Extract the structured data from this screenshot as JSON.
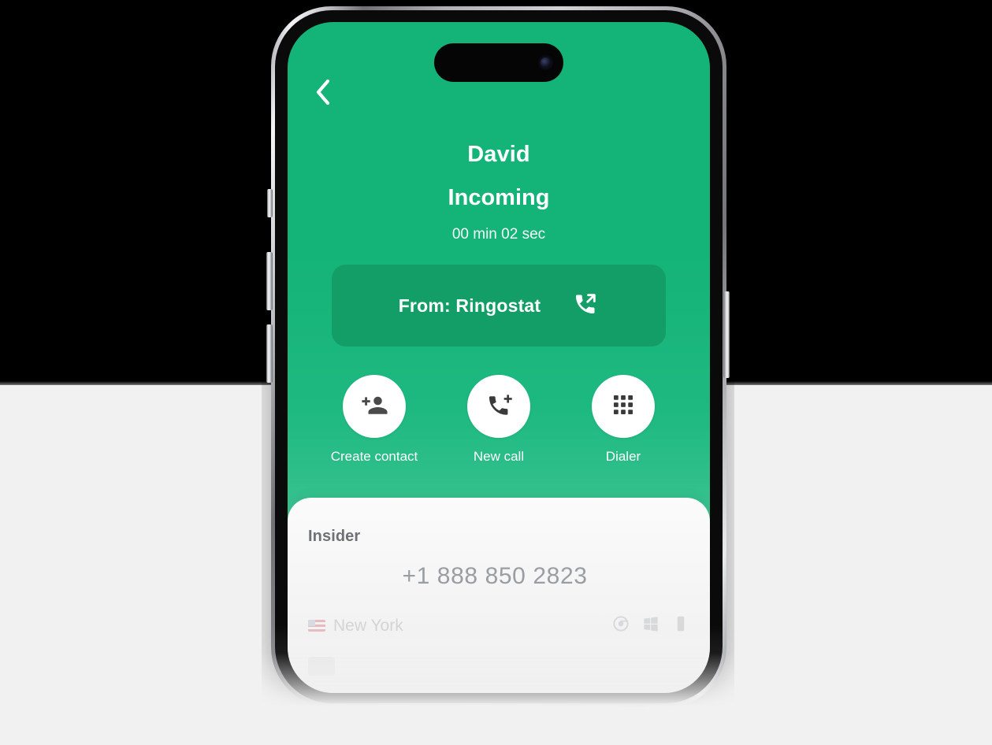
{
  "theme": {
    "brand_green_top": "#14b377",
    "brand_green_bottom": "#7ed3b3",
    "card_green": "#149e67",
    "sheet_bg": "#f2f2f2",
    "page_bg_top": "#000000",
    "page_bg_bottom": "#f1f1f1",
    "white": "#ffffff"
  },
  "call_screen": {
    "back_icon": "chevron-left-icon",
    "caller_name": "David",
    "call_status": "Incoming",
    "call_duration": "00 min 02 sec",
    "from_card": {
      "label": "From: Ringostat",
      "icon": "call-outgoing-icon"
    },
    "actions": [
      {
        "label": "Create contact",
        "icon": "person-add-icon"
      },
      {
        "label": "New call",
        "icon": "phone-add-icon"
      },
      {
        "label": "Dialer",
        "icon": "dialpad-icon"
      }
    ]
  },
  "bottom_sheet": {
    "title": "Insider",
    "phone_number": "+1 888 850 2823",
    "location": "New York",
    "location_flag_icon": "us-flag-icon",
    "source_icons": [
      {
        "icon": "browser-icon"
      },
      {
        "icon": "windows-icon"
      },
      {
        "icon": "device-icon"
      }
    ]
  },
  "device": {
    "dynamic_island_icon": "camera-lens-icon",
    "buttons": [
      {
        "icon": "mute-switch-button"
      },
      {
        "icon": "volume-up-button"
      },
      {
        "icon": "volume-down-button"
      },
      {
        "icon": "power-button"
      }
    ]
  }
}
